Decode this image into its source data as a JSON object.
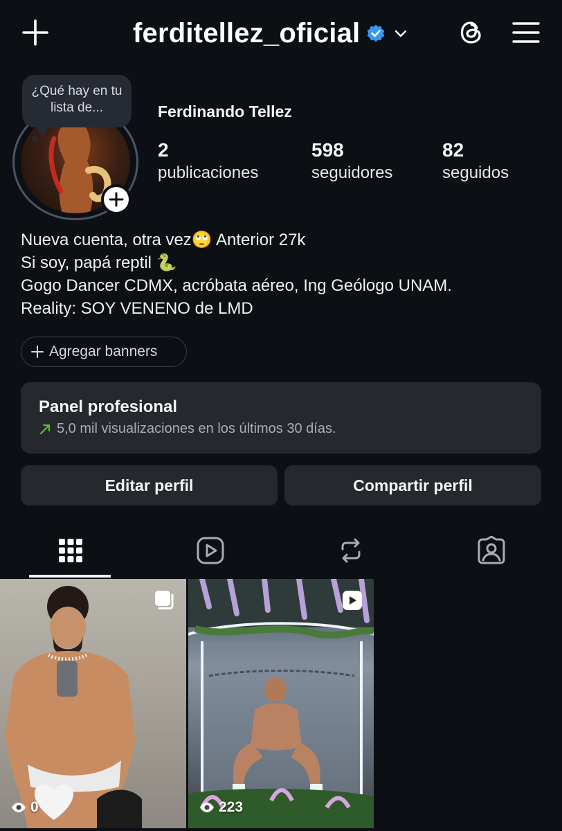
{
  "header": {
    "username": "ferditellez_oficial",
    "verified": true,
    "icons": [
      "plus-icon",
      "verified-badge-icon",
      "chevron-down-icon",
      "threads-icon",
      "hamburger-menu-icon"
    ]
  },
  "profile": {
    "note_text": "¿Qué hay en tu lista de...",
    "full_name": "Ferdinando Tellez",
    "stats": [
      {
        "value": "2",
        "label": "publicaciones"
      },
      {
        "value": "598",
        "label": "seguidores"
      },
      {
        "value": "82",
        "label": "seguidos"
      }
    ],
    "bio_lines": [
      "Nueva cuenta, otra vez🙄 Anterior 27k",
      "Si soy, papá reptil 🐍",
      "Gogo Dancer CDMX, acróbata aéreo, Ing Geólogo UNAM.",
      "Reality: SOY VENENO de LMD"
    ]
  },
  "banners_button": "Agregar banners",
  "professional_panel": {
    "title": "Panel profesional",
    "subtitle": "5,0 mil visualizaciones en los últimos 30 días."
  },
  "actions": {
    "edit": "Editar perfil",
    "share": "Compartir perfil"
  },
  "tabs": [
    {
      "icon": "grid-icon",
      "active": true
    },
    {
      "icon": "reels-icon",
      "active": false
    },
    {
      "icon": "reposts-icon",
      "active": false
    },
    {
      "icon": "tagged-icon",
      "active": false
    }
  ],
  "posts": [
    {
      "type": "carousel",
      "views": "0",
      "badge_icon": "carousel-icon"
    },
    {
      "type": "reel",
      "views": "223",
      "badge_icon": "reel-icon"
    }
  ],
  "colors": {
    "background": "#0c1014",
    "surface": "#25292e",
    "verified": "#3897f0",
    "trend_up": "#58c322"
  }
}
